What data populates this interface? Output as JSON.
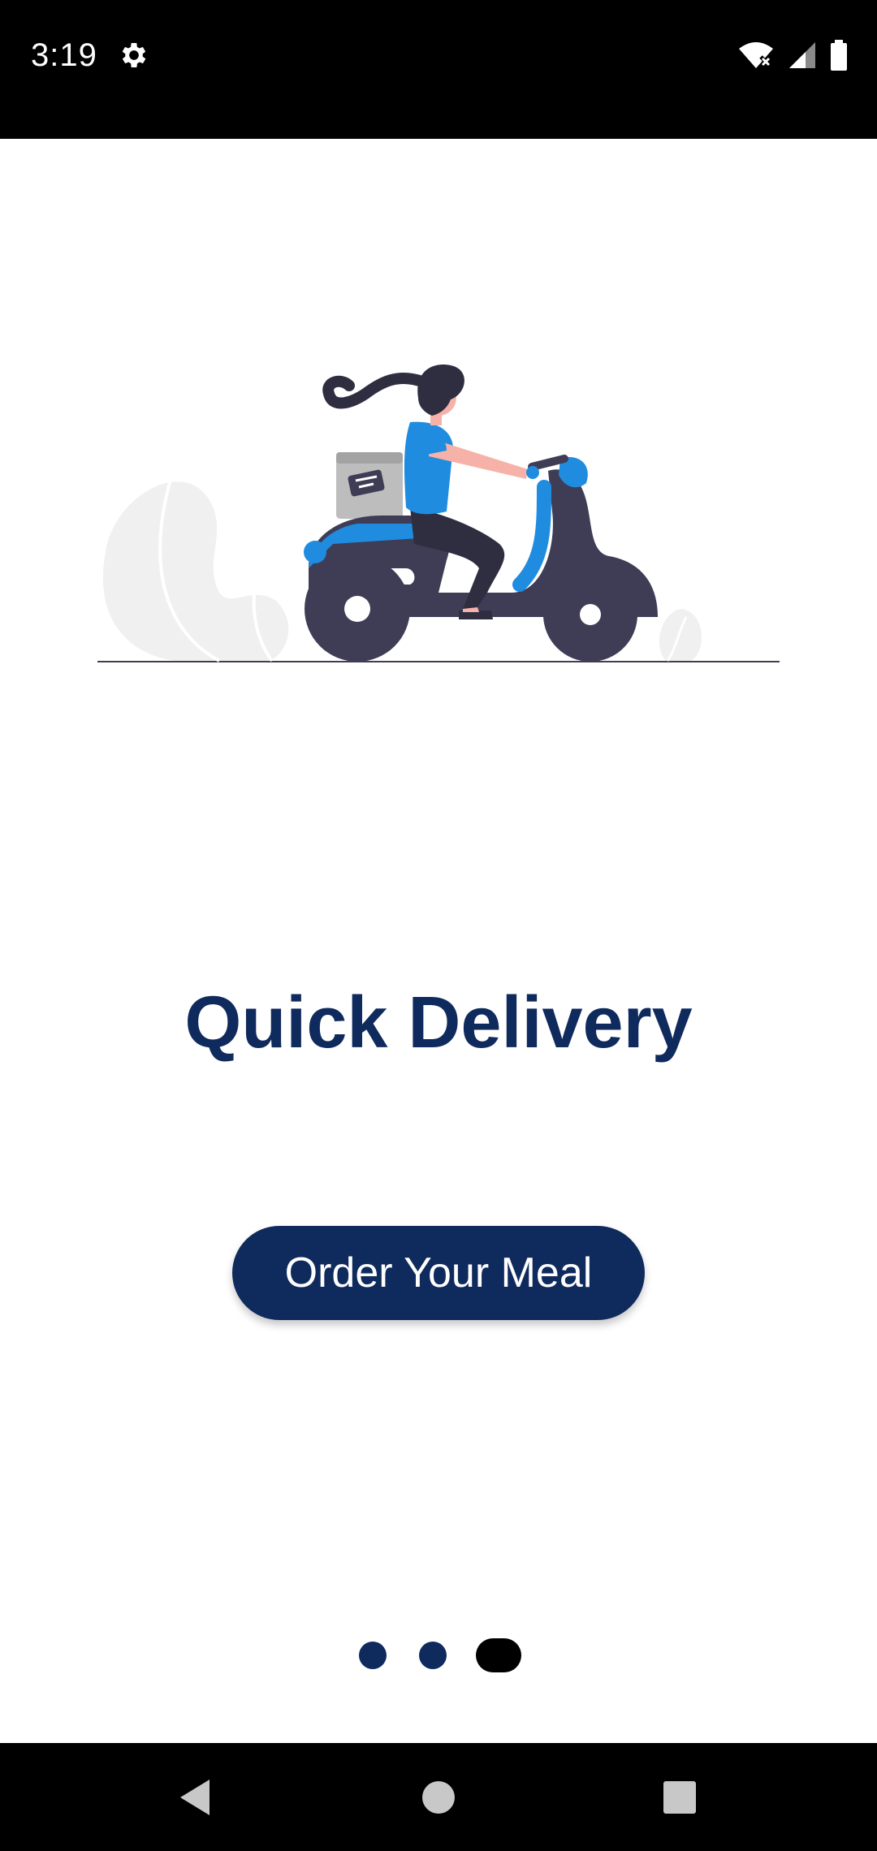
{
  "status_bar": {
    "time": "3:19",
    "icons": [
      "gear-icon",
      "wifi-off-icon",
      "cell-signal-icon",
      "battery-icon"
    ]
  },
  "illustration": {
    "subject": "delivery-scooter-illustration",
    "colors": {
      "accent": "#1f8ce0",
      "dark": "#3f3d56",
      "skin": "#f6b2a8",
      "foliage": "#f0f0f0",
      "box": "#bdbdbd"
    }
  },
  "screen": {
    "title": "Quick Delivery",
    "cta_label": "Order Your Meal"
  },
  "pager": {
    "count": 3,
    "active_index": 2
  },
  "nav_bar": {
    "icons": [
      "back-icon",
      "home-icon",
      "recents-icon"
    ]
  },
  "colors": {
    "brand": "#0f2a5c",
    "background": "#ffffff",
    "system_bars": "#000000"
  }
}
